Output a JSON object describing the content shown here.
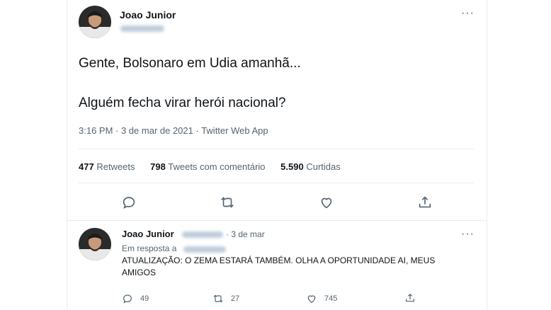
{
  "main_tweet": {
    "author_name": "Joao Junior",
    "text_line1": "Gente, Bolsonaro em Udia amanhã...",
    "text_line2": "Alguém fecha virar herói nacional?",
    "timestamp": "3:16 PM · 3 de mar de 2021 · Twitter Web App",
    "stats": {
      "retweets_count": "477",
      "retweets_label": "Retweets",
      "quotes_count": "798",
      "quotes_label": "Tweets com comentário",
      "likes_count": "5.590",
      "likes_label": "Curtidas"
    },
    "more_label": "···"
  },
  "reply_tweet": {
    "author_name": "Joao Junior",
    "date": "· 3 de mar",
    "replying_to_label": "Em resposta a",
    "text": "ATUALIZAÇÃO: O ZEMA ESTARÁ TAMBÉM. OLHA A OPORTUNIDADE AI, MEUS AMIGOS",
    "more_label": "···",
    "actions": {
      "reply_count": "49",
      "retweet_count": "27",
      "like_count": "745"
    }
  },
  "colors": {
    "text_primary": "#0f1419",
    "text_secondary": "#536471",
    "divider": "#e6ecf0"
  }
}
